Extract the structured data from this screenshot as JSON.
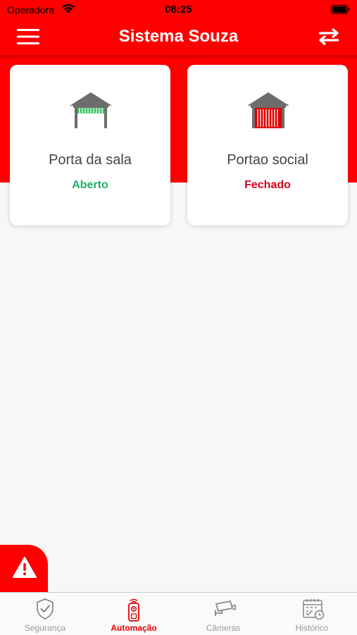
{
  "status_bar": {
    "carrier": "Operadora",
    "time": "08:25"
  },
  "header": {
    "title": "Sistema Souza",
    "left_icon": "menu-icon",
    "right_icon": "swap-arrows-icon"
  },
  "colors": {
    "brand": "#ff0000",
    "open": "#1fb36b",
    "closed": "#d0021b",
    "tab_active": "#e60000",
    "tab_inactive": "#999999"
  },
  "devices": [
    {
      "name": "Porta da sala",
      "status": "Aberto",
      "icon": "garage-open-icon"
    },
    {
      "name": "Portao social",
      "status": "Fechado",
      "icon": "garage-closed-icon"
    }
  ],
  "alert_button": {
    "icon": "warning-icon"
  },
  "tabs": [
    {
      "label": "Segurança",
      "icon": "shield-check-icon",
      "active": false
    },
    {
      "label": "Automação",
      "icon": "remote-control-icon",
      "active": true
    },
    {
      "label": "Câmeras",
      "icon": "security-camera-icon",
      "active": false
    },
    {
      "label": "Histórico",
      "icon": "calendar-history-icon",
      "active": false
    }
  ]
}
